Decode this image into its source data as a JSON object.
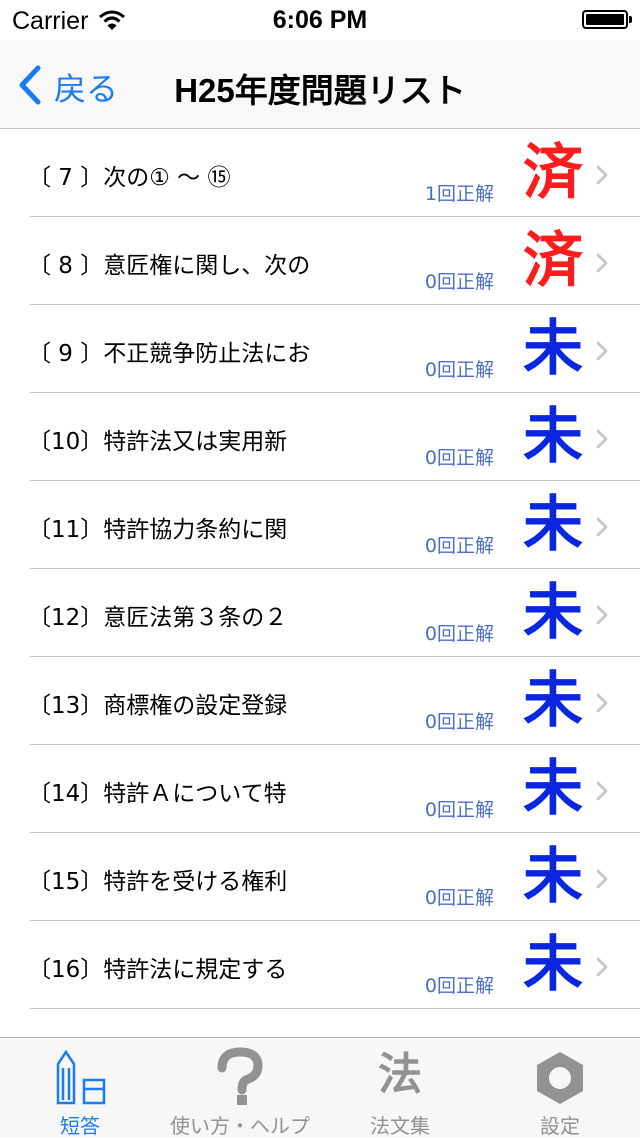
{
  "status_bar": {
    "carrier": "Carrier",
    "time": "6:06 PM"
  },
  "nav": {
    "back_label": "戻る",
    "title": "H25年度問題リスト"
  },
  "colors": {
    "accent": "#1a7cf5",
    "done": "#ff1c1c",
    "todo": "#0a26e0",
    "count": "#4a6fc4"
  },
  "questions": [
    {
      "title": "〔 7 〕次の① 〜 ⑮",
      "count": "1回正解",
      "status": "済",
      "state": "done"
    },
    {
      "title": "〔 8 〕意匠権に関し、次の",
      "count": "0回正解",
      "status": "済",
      "state": "done"
    },
    {
      "title": "〔 9 〕不正競争防止法にお",
      "count": "0回正解",
      "status": "未",
      "state": "todo"
    },
    {
      "title": "〔10〕特許法又は実用新",
      "count": "0回正解",
      "status": "未",
      "state": "todo"
    },
    {
      "title": "〔11〕特許協力条約に関",
      "count": "0回正解",
      "status": "未",
      "state": "todo"
    },
    {
      "title": "〔12〕意匠法第３条の２",
      "count": "0回正解",
      "status": "未",
      "state": "todo"
    },
    {
      "title": "〔13〕商標権の設定登録",
      "count": "0回正解",
      "status": "未",
      "state": "todo"
    },
    {
      "title": "〔14〕特許Ａについて特",
      "count": "0回正解",
      "status": "未",
      "state": "todo"
    },
    {
      "title": "〔15〕特許を受ける権利",
      "count": "0回正解",
      "status": "未",
      "state": "todo"
    },
    {
      "title": "〔16〕特許法に規定する",
      "count": "0回正解",
      "status": "未",
      "state": "todo"
    }
  ],
  "tabs": [
    {
      "label": "短答",
      "icon": "building-icon",
      "active": true
    },
    {
      "label": "使い方・ヘルプ",
      "icon": "question-mark-icon",
      "active": false
    },
    {
      "label": "法文集",
      "icon": "law-character-icon",
      "glyph": "法",
      "active": false
    },
    {
      "label": "設定",
      "icon": "hex-nut-icon",
      "active": false
    }
  ]
}
